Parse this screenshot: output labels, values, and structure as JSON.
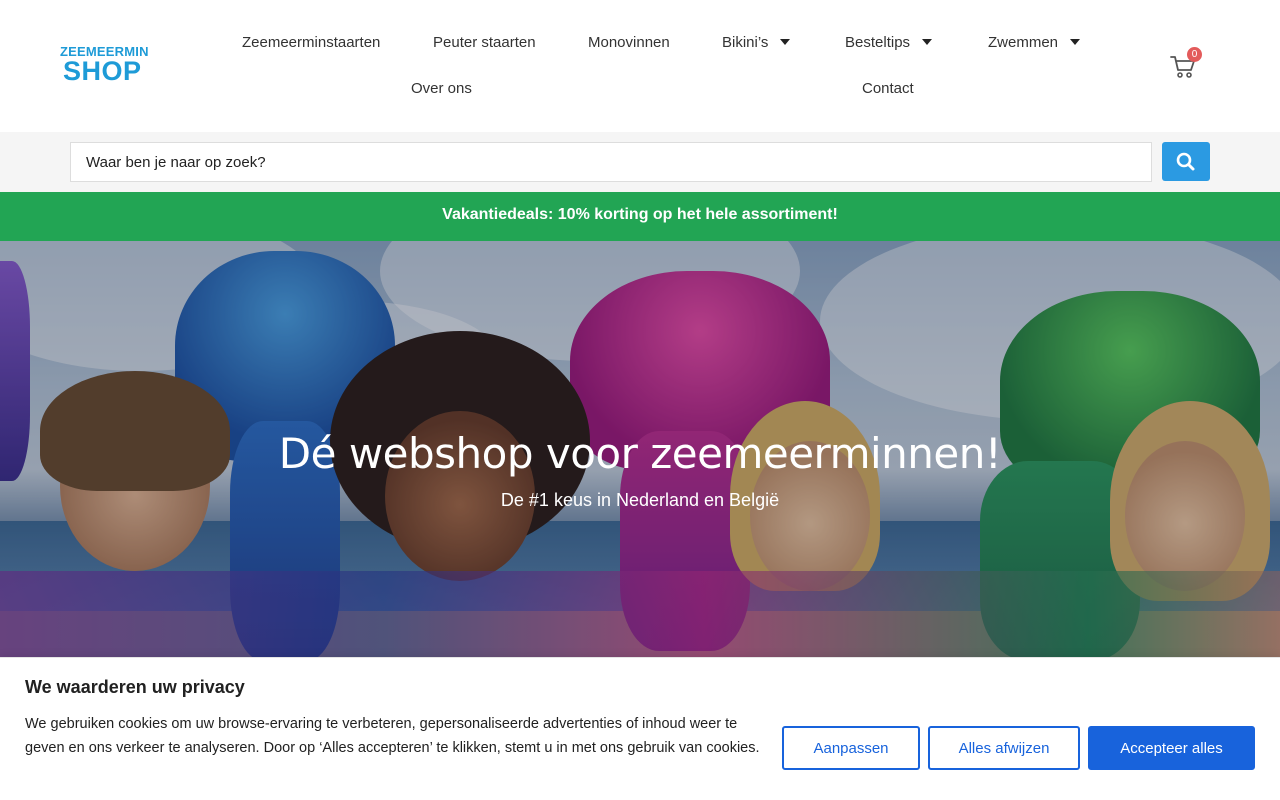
{
  "logo": {
    "top": "ZEEMEERMIN",
    "bottom": "SHOP"
  },
  "nav": {
    "items": [
      {
        "label": "Zeemeerminstaarten",
        "has_dropdown": false
      },
      {
        "label": "Peuter staarten",
        "has_dropdown": false
      },
      {
        "label": "Monovinnen",
        "has_dropdown": false
      },
      {
        "label": "Bikini’s",
        "has_dropdown": true
      },
      {
        "label": "Besteltips",
        "has_dropdown": true
      },
      {
        "label": "Zwemmen",
        "has_dropdown": true
      },
      {
        "label": "Over ons",
        "has_dropdown": false
      },
      {
        "label": "Contact",
        "has_dropdown": false
      }
    ]
  },
  "cart": {
    "count": "0",
    "icon": "cart-icon"
  },
  "search": {
    "placeholder": "Waar ben je naar op zoek?",
    "button_icon": "search-icon"
  },
  "promo": {
    "text": "Vakantiedeals: 10% korting op het hele assortiment!",
    "color": "#22a554"
  },
  "hero": {
    "title": "Dé webshop voor zeemeerminnen!",
    "subtitle": "De #1 keus in Nederland en België"
  },
  "cookie": {
    "title": "We waarderen uw privacy",
    "text": "We gebruiken cookies om uw browse-ervaring te verbeteren, gepersonaliseerde advertenties of inhoud weer te geven en ons verkeer te analyseren. Door op ‘Alles accepteren’ te klikken, stemt u in met ons gebruik van cookies.",
    "buttons": {
      "customize": "Aanpassen",
      "reject": "Alles afwijzen",
      "accept": "Accepteer alles"
    },
    "accent_color": "#1863dc"
  }
}
